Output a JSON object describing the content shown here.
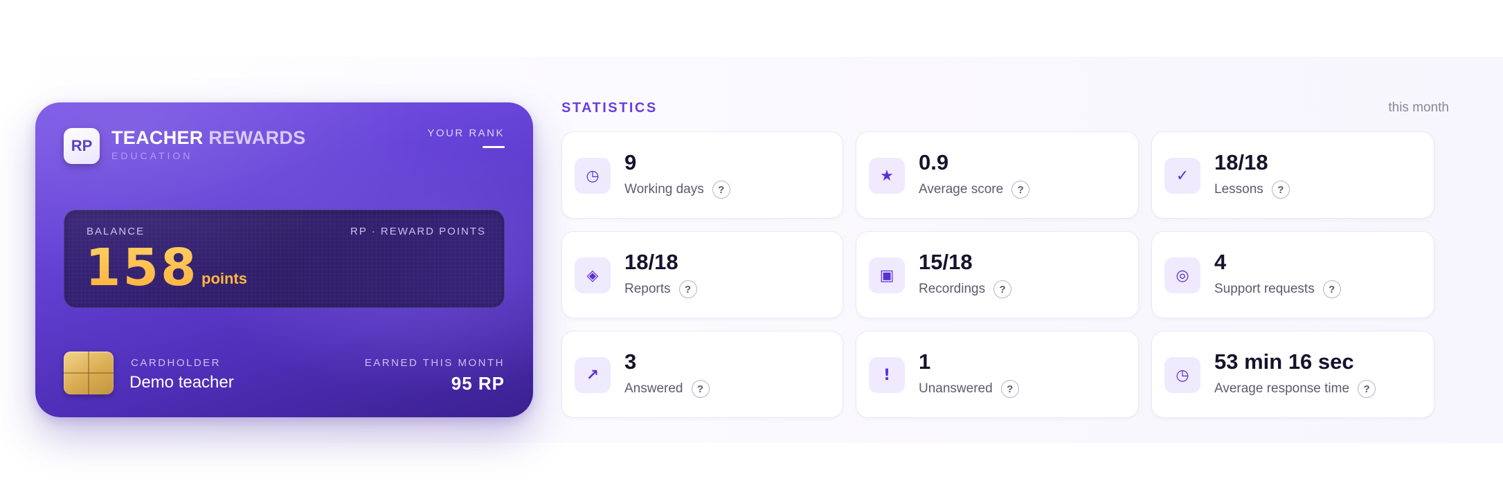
{
  "card": {
    "logo": "RP",
    "brand_word1": "TEACHER",
    "brand_word2": "REWARDS",
    "brand_sub": "EDUCATION",
    "rank_label": "YOUR RANK",
    "rank_value": "—",
    "balance_label": "BALANCE",
    "currency_label": "RP · REWARD POINTS",
    "balance_value": "158",
    "balance_unit": "points",
    "cardholder_label": "CARDHOLDER",
    "cardholder_name": "Demo teacher",
    "earned_label": "EARNED THIS MONTH",
    "earned_value": "95 RP"
  },
  "stats": {
    "title": "STATISTICS",
    "period": "this month",
    "help_glyph": "?",
    "tiles": [
      {
        "value": "9",
        "label": "Working days",
        "icon": "clock-icon",
        "glyph": "◷"
      },
      {
        "value": "0.9",
        "label": "Average score",
        "icon": "star-icon",
        "glyph": "★"
      },
      {
        "value": "18/18",
        "label": "Lessons",
        "icon": "check-icon",
        "glyph": "✓"
      },
      {
        "value": "18/18",
        "label": "Reports",
        "icon": "diamond-icon",
        "glyph": "◈"
      },
      {
        "value": "15/18",
        "label": "Recordings",
        "icon": "recording-square-icon",
        "glyph": "▣"
      },
      {
        "value": "4",
        "label": "Support requests",
        "icon": "lifebuoy-icon",
        "glyph": "◎"
      },
      {
        "value": "3",
        "label": "Answered",
        "icon": "arrow-up-right-icon",
        "glyph": "↗"
      },
      {
        "value": "1",
        "label": "Unanswered",
        "icon": "exclamation-icon",
        "glyph": "!"
      },
      {
        "value": "53 min 16 sec",
        "label": "Average response time",
        "icon": "clock-icon",
        "glyph": "◷"
      }
    ]
  },
  "colors": {
    "accent": "#6a3de0",
    "card_gradient_start": "#7a55e6",
    "card_gradient_end": "#3a2090",
    "points": "#ffb840"
  }
}
